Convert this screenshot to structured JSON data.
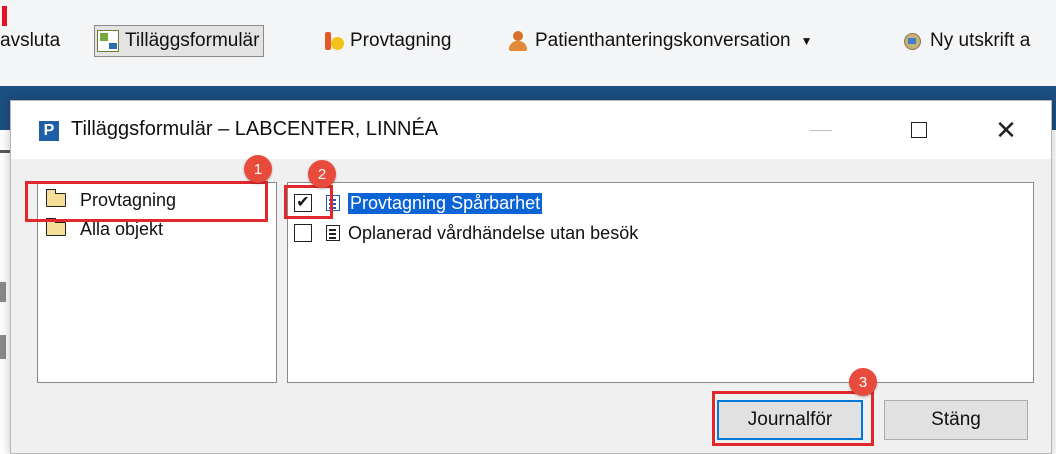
{
  "toolbar": {
    "items": [
      {
        "label": "avsluta"
      },
      {
        "label": "Tilläggsformulär",
        "icon": "forms-icon"
      },
      {
        "label": "Provtagning",
        "icon": "flask-icon"
      },
      {
        "label": "Patienthanteringskonversation",
        "icon": "person-icon"
      },
      {
        "label": "Ny utskrift a",
        "icon": "tag-icon"
      }
    ]
  },
  "dialog": {
    "icon_letter": "P",
    "title": "Tilläggsformulär – LABCENTER, LINNÉA",
    "folders": [
      {
        "label": "Provtagning",
        "selected": true
      },
      {
        "label": "Alla objekt",
        "selected": false
      }
    ],
    "items": [
      {
        "label": "Provtagning Spårbarhet",
        "checked": true,
        "selected": true
      },
      {
        "label": "Oplanerad vårdhändelse utan besök",
        "checked": false,
        "selected": false
      }
    ],
    "buttons": {
      "journal": "Journalför",
      "close": "Stäng"
    },
    "window_controls": {
      "minimize": "—",
      "maximize": "□",
      "close": "✕"
    }
  },
  "annotations": [
    "1",
    "2",
    "3"
  ],
  "colors": {
    "highlight": "#e0282e",
    "badge": "#e84b3c",
    "selection": "#0a64d6",
    "app_band": "#1c4f82"
  }
}
